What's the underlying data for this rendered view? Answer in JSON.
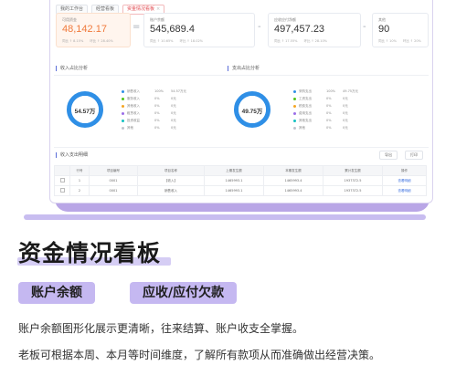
{
  "tabs": [
    {
      "label": "我的工作台"
    },
    {
      "label": "经营看板"
    },
    {
      "label": "资金情况看板",
      "active": true
    }
  ],
  "kpis": [
    {
      "label": "可用资金",
      "value": "48,142.17",
      "sub": "同比 ↑ 8.15%　　环比 ↑ 28.40%"
    },
    {
      "label": "账户余额",
      "value": "545,689.4",
      "sub": "同比 ↑ 10.65%　　环比 ↑ 18.02%"
    },
    {
      "label": "应收应付净额",
      "value": "497,457.23",
      "sub": "同比 ↑ 17.55%　　环比 ↑ 28.10%"
    },
    {
      "label": "其他",
      "value": "90",
      "sub": "同比 ↑ 10%　　环比 ↑ 20%"
    }
  ],
  "operators": [
    "=",
    "-",
    "-"
  ],
  "left_section": {
    "title": "收入占比分析",
    "total": "54.57万",
    "legend": [
      {
        "name": "销售收入",
        "pct": "100%",
        "amount": "54.57万元",
        "color": "#2f8fe6"
      },
      {
        "name": "服务收入",
        "pct": "0%",
        "amount": "0元",
        "color": "#52c41a"
      },
      {
        "name": "其他收入",
        "pct": "0%",
        "amount": "0元",
        "color": "#f5a623"
      },
      {
        "name": "租赁收入",
        "pct": "0%",
        "amount": "0元",
        "color": "#9b6ee8"
      },
      {
        "name": "投资收益",
        "pct": "0%",
        "amount": "0元",
        "color": "#13c2c2"
      },
      {
        "name": "其他",
        "pct": "0%",
        "amount": "0元",
        "color": "#c0c4cc"
      }
    ]
  },
  "right_section": {
    "title": "支出占比分析",
    "total": "49.75万",
    "legend": [
      {
        "name": "采购支出",
        "pct": "100%",
        "amount": "49.75万元",
        "color": "#2f8fe6"
      },
      {
        "name": "工资支出",
        "pct": "0%",
        "amount": "0元",
        "color": "#52c41a"
      },
      {
        "name": "税费支出",
        "pct": "0%",
        "amount": "0元",
        "color": "#f5a623"
      },
      {
        "name": "费用支出",
        "pct": "0%",
        "amount": "0元",
        "color": "#9b6ee8"
      },
      {
        "name": "其他支出",
        "pct": "0%",
        "amount": "0元",
        "color": "#13c2c2"
      },
      {
        "name": "其他",
        "pct": "0%",
        "amount": "0元",
        "color": "#c0c4cc"
      }
    ]
  },
  "detail": {
    "title": "收入支出明细",
    "buttons": [
      "导出",
      "打印"
    ],
    "columns": [
      "",
      "行号",
      "项目编号",
      "项目名称",
      "上期发生额",
      "本期发生额",
      "累计发生额",
      "操作"
    ],
    "rows": [
      {
        "no": "1",
        "code": "0001",
        "name": "【收入】",
        "prev": "1465993.1",
        "curr": "1465993.4",
        "total": "1937372.5",
        "action": "查看明细"
      },
      {
        "no": "2",
        "code": "0001",
        "name": "销售收入",
        "prev": "1465993.1",
        "curr": "1465993.4",
        "total": "1937372.5",
        "action": "查看明细"
      }
    ]
  },
  "marketing": {
    "headline": "资金情况看板",
    "pills": [
      "账户余额",
      "应收/应付欠款"
    ],
    "lines": [
      "账户余额图形化展示更清晰，往来结算、账户收支全掌握。",
      "老板可根据本周、本月等时间维度，了解所有款项从而准确做出经营决策。"
    ]
  }
}
